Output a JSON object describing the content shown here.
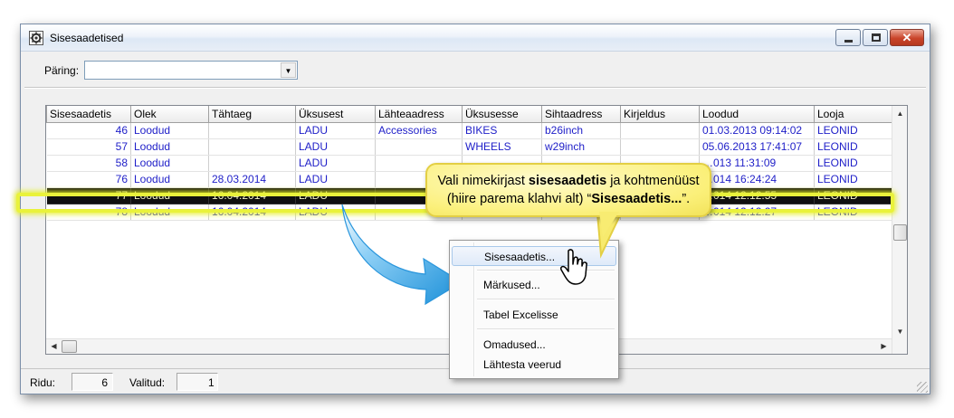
{
  "window": {
    "title": "Sisesaadetised"
  },
  "query": {
    "label": "Päring:",
    "value": ""
  },
  "grid": {
    "columns": [
      "Sisesaadetis",
      "Olek",
      "Tähtaeg",
      "Üksusest",
      "Lähteaadress",
      "Üksusesse",
      "Sihtaadress",
      "Kirjeldus",
      "Loodud",
      "Looja"
    ],
    "rows": [
      [
        "46",
        "Loodud",
        "",
        "LADU",
        "Accessories",
        "BIKES",
        "b26inch",
        "",
        "01.03.2013 09:14:02",
        "LEONID"
      ],
      [
        "57",
        "Loodud",
        "",
        "LADU",
        "",
        "WHEELS",
        "w29inch",
        "",
        "05.06.2013 17:41:07",
        "LEONID"
      ],
      [
        "58",
        "Loodud",
        "",
        "LADU",
        "",
        "",
        "",
        "",
        "…013 11:31:09",
        "LEONID"
      ],
      [
        "76",
        "Loodud",
        "28.03.2014",
        "LADU",
        "",
        "",
        "",
        "",
        "…014 16:24:24",
        "LEONID"
      ],
      [
        "77",
        "Loodud",
        "16.04.2014",
        "LADU",
        "",
        "",
        "",
        "",
        "…014 12:12:55",
        "LEONID"
      ],
      [
        "78",
        "Loodud",
        "16.04.2014",
        "LADU",
        "",
        "",
        "",
        "",
        "…014 12:12:27",
        "LEONID"
      ]
    ],
    "selected_row": 4
  },
  "status": {
    "rows_label": "Ridu:",
    "rows_value": "6",
    "selected_label": "Valitud:",
    "selected_value": "1"
  },
  "context_menu": {
    "items": [
      "Sisesaadetis...",
      "Märkused...",
      "Tabel Excelisse",
      "Omadused...",
      "Lähtesta veerud"
    ],
    "hovered": 0
  },
  "callout": {
    "line1_pre": "Vali nimekirjast ",
    "line1_bold": "sisesaadetis",
    "line1_post": " ja kohtmenüüst",
    "line2_pre": "(hiire parema klahvi alt) “",
    "line2_bold": "Sisesaadetis...",
    "line2_post": "”."
  },
  "colors": {
    "link_text": "#1e1ec8",
    "selected_row_bg": "#101010",
    "selected_row_text": "#f2f2c6",
    "highlight_glow": "#e9f23b",
    "callout_bg": "#fbf07a",
    "arrow": "#3aa8e8"
  },
  "icons": {
    "app": "settings-gear-icon",
    "minimize": "minimize-icon",
    "maximize": "maximize-icon",
    "close": "close-icon",
    "cursor": "hand-pointer-icon"
  }
}
